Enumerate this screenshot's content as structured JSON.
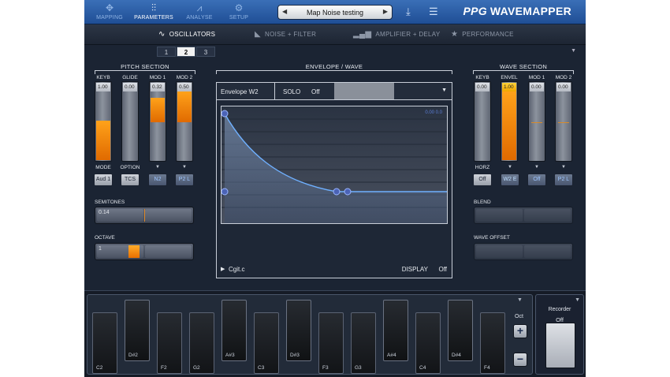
{
  "topbar": {
    "nav": [
      {
        "label": "MAPPING",
        "icon": "crosshair-icon",
        "active": false
      },
      {
        "label": "PARAMETERS",
        "icon": "sliders-icon",
        "active": true
      },
      {
        "label": "ANALYSE",
        "icon": "analyse-icon",
        "active": false
      },
      {
        "label": "SETUP",
        "icon": "gear-icon",
        "active": false
      }
    ],
    "preset_name": "Map Noise testing",
    "logo_ppg": "PPG",
    "logo_text": "WAVEMAPPER"
  },
  "tabs": [
    {
      "label": "OSCILLATORS",
      "active": true
    },
    {
      "label": "NOISE + FILTER",
      "active": false
    },
    {
      "label": "AMPLIFIER + DELAY",
      "active": false
    },
    {
      "label": "PERFORMANCE",
      "active": false
    }
  ],
  "subtabs": [
    "1",
    "2",
    "3"
  ],
  "active_subtab": "2",
  "pitch": {
    "title": "PITCH SECTION",
    "faders": [
      {
        "label": "KEYB",
        "value": "1.00",
        "level": 0.52
      },
      {
        "label": "GLIDE",
        "value": "0.00",
        "level": 0
      },
      {
        "label": "MOD 1",
        "value": "0.32",
        "level": 0.32
      },
      {
        "label": "MOD 2",
        "value": "0.50",
        "level": 0.5
      }
    ],
    "mode_label": "MODE",
    "mode_value": "Aud 1",
    "option_label": "OPTION",
    "option_value": "TCS",
    "mod1_src": "N2",
    "mod2_src": "P2 L",
    "semitones_label": "SEMITONES",
    "semitones_value": "0.14",
    "octave_label": "OCTAVE",
    "octave_value": "1"
  },
  "envelope": {
    "title": "ENVELOPE / WAVE",
    "name": "Envelope W2",
    "solo_label": "SOLO",
    "solo_value": "Off",
    "graph_readout": "0.00  0.0",
    "footer_name": "Cgit.c",
    "display_label": "DISPLAY",
    "display_value": "Off"
  },
  "wave": {
    "title": "WAVE SECTION",
    "faders": [
      {
        "label": "KEYB",
        "value": "0.00",
        "level": 0
      },
      {
        "label": "ENVEL",
        "value": "1.00",
        "level": 1.0
      },
      {
        "label": "MOD 1",
        "value": "0.00",
        "level": 0
      },
      {
        "label": "MOD 2",
        "value": "0.00",
        "level": 0
      }
    ],
    "horz_label": "HORZ",
    "horz_value": "Off",
    "src_envel": "W2 E",
    "src_mod1": "Off",
    "src_mod2": "P2 L",
    "blend_label": "BLEND",
    "wave_offset_label": "WAVE OFFSET"
  },
  "keyboard": {
    "oct_label": "Oct",
    "white_labels": [
      "C2",
      "",
      "F2",
      "G2",
      "",
      "C3",
      "",
      "F3",
      "G3",
      "",
      "C4",
      "",
      "F4"
    ],
    "black_labels": [
      "D#2",
      "",
      "A#3",
      "",
      "D#3",
      "",
      "A#4",
      "",
      "D#4",
      ""
    ],
    "recorder_title": "Recorder",
    "recorder_state": "Off"
  },
  "colors": {
    "accent": "#f28a0c",
    "topbar": "#2f63ad",
    "panel": "#1b2433"
  }
}
